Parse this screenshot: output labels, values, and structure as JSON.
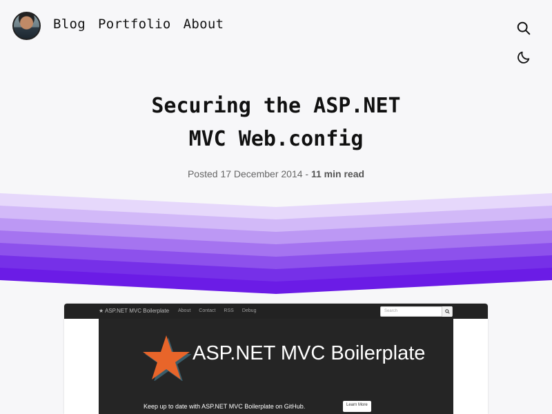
{
  "nav": {
    "items": [
      {
        "label": "Blog"
      },
      {
        "label": "Portfolio"
      },
      {
        "label": "About"
      }
    ]
  },
  "icons": {
    "search": "search-icon",
    "theme": "moon-icon",
    "avatar": "avatar"
  },
  "post": {
    "title_line1": "Securing the ASP.NET",
    "title_line2": "MVC Web.config",
    "posted_prefix": "Posted",
    "date": "17 December 2014",
    "separator": "-",
    "read_time": "11 min read"
  },
  "colors": {
    "background": "#f7f7f9",
    "wave_light": "#e6d8fb",
    "wave_dark": "#6b1ce6"
  },
  "screenshot": {
    "brand": "ASP.NET MVC Boilerplate",
    "links": [
      "About",
      "Contact",
      "RSS",
      "Debug"
    ],
    "search_placeholder": "Search",
    "hero_title": "ASP.NET MVC Boilerplate",
    "hero_subtitle": "Keep up to date with ASP.NET MVC Boilerplate on GitHub.",
    "learn_more": "Learn More"
  }
}
